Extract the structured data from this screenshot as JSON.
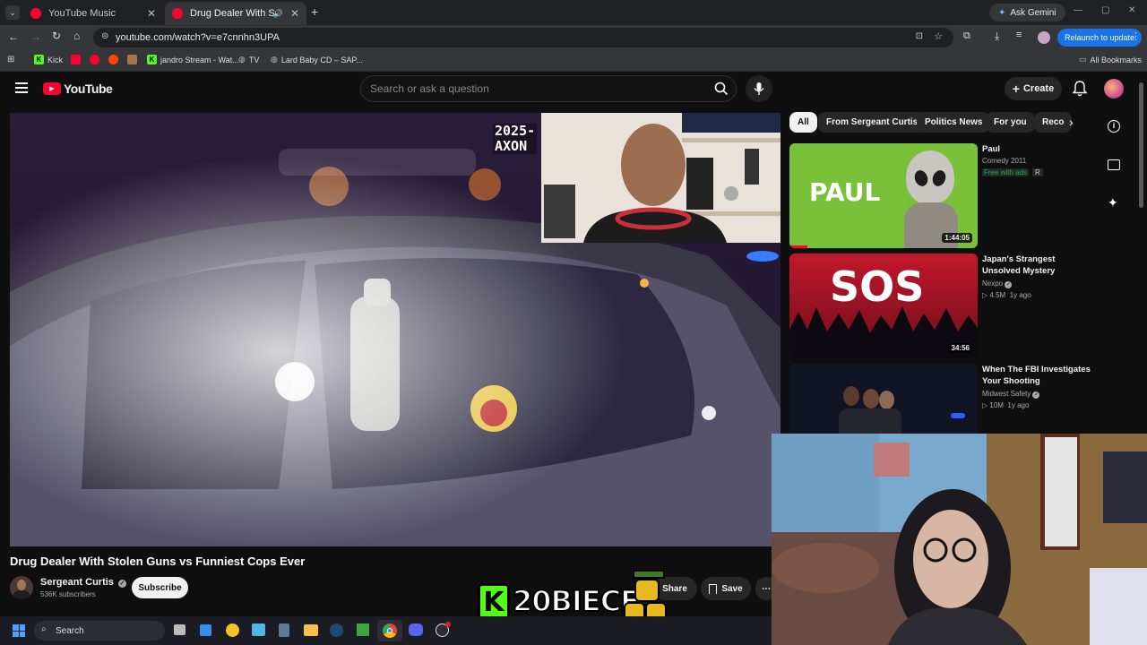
{
  "browser": {
    "tabs": [
      {
        "title": "YouTube Music"
      },
      {
        "title": "Drug Dealer With Stolen Gu"
      }
    ],
    "url": "youtube.com/watch?v=e7cnnhn3UPA",
    "ask_gemini": "Ask Gemini",
    "relaunch": "Relaunch to update",
    "bookmarks": [
      "Kick",
      "jandro Stream - Wat...",
      "TV",
      "Lard Baby CD – SAP..."
    ],
    "all_bookmarks": "All Bookmarks"
  },
  "youtube": {
    "logo_text": "YouTube",
    "search_placeholder": "Search or ask a question",
    "create_label": "Create",
    "video": {
      "watermark_line1": "2025-",
      "watermark_line2": "AXON",
      "title": "Drug Dealer With Stolen Guns vs Funniest Cops Ever",
      "channel": "Sergeant Curtis",
      "subscribers": "536K subscribers",
      "subscribe_label": "Subscribe",
      "share_label": "Share",
      "save_label": "Save"
    },
    "chips": [
      "All",
      "From Sergeant Curtis",
      "Politics News",
      "For you",
      "Reco"
    ],
    "recommendations": [
      {
        "title": "Paul",
        "channel": "Comedy 2011",
        "badge": "Free with ads",
        "rating": "R",
        "duration": "1:44:05",
        "thumb_text": "PAUL"
      },
      {
        "title": "Japan's Strangest Unsolved Mystery",
        "channel": "Nexpo",
        "views": "4.5M",
        "age": "1y ago",
        "duration": "34:56",
        "thumb_text": "SOS"
      },
      {
        "title": "When The FBI Investigates Your Shooting",
        "channel": "Midwest Safety",
        "views": "10M",
        "age": "1y ago"
      }
    ]
  },
  "overlay": {
    "kick_letter": "K",
    "streamer": "20BIECE"
  },
  "taskbar": {
    "search": "Search"
  },
  "colors": {
    "yt_red": "#ff0033",
    "kick_green": "#53fc18",
    "accent_blue": "#1a73e8"
  }
}
